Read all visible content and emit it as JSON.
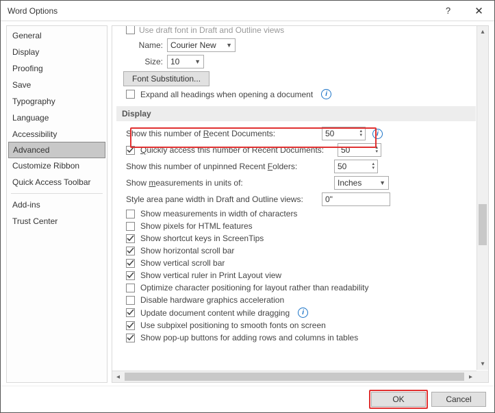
{
  "title": "Word Options",
  "sidebar": {
    "items": [
      {
        "label": "General"
      },
      {
        "label": "Display"
      },
      {
        "label": "Proofing"
      },
      {
        "label": "Save"
      },
      {
        "label": "Typography"
      },
      {
        "label": "Language"
      },
      {
        "label": "Accessibility"
      },
      {
        "label": "Advanced",
        "selected": true
      },
      {
        "label": "Customize Ribbon"
      },
      {
        "label": "Quick Access Toolbar"
      },
      {
        "sep": true
      },
      {
        "label": "Add-ins"
      },
      {
        "label": "Trust Center"
      }
    ]
  },
  "font": {
    "draft_label": "Use draft font in Draft and Outline views",
    "name_label": "Name:",
    "name_value": "Courier New",
    "size_label": "Size:",
    "size_value": "10",
    "sub_button": "Font Substitution...",
    "expand": "Expand all headings when opening a document"
  },
  "display": {
    "header": "Display",
    "recent_docs_label": "Show this number of Recent Documents:",
    "recent_docs_value": "50",
    "quick_access_label": "Quickly access this number of Recent Documents:",
    "quick_access_value": "50",
    "unpinned_label": "Show this number of unpinned Recent Folders:",
    "unpinned_value": "50",
    "units_label": "Show measurements in units of:",
    "units_value": "Inches",
    "style_pane_label": "Style area pane width in Draft and Outline views:",
    "style_pane_value": "0\"",
    "checks": [
      {
        "label": "Show measurements in width of characters",
        "checked": false,
        "u": "w"
      },
      {
        "label": "Show pixels for HTML features",
        "checked": false,
        "u": "x"
      },
      {
        "label": "Show shortcut keys in ScreenTips",
        "checked": true,
        "u": "h"
      },
      {
        "label": "Show horizontal scroll bar",
        "checked": true,
        "u": "z"
      },
      {
        "label": "Show vertical scroll bar",
        "checked": true,
        "u": "v"
      },
      {
        "label": "Show vertical ruler in Print Layout view",
        "checked": true
      },
      {
        "label": "Optimize character positioning for layout rather than readability",
        "checked": false
      },
      {
        "label": "Disable hardware graphics acceleration",
        "checked": false
      },
      {
        "label": "Update document content while dragging",
        "checked": true,
        "info": true,
        "u": "d"
      },
      {
        "label": "Use subpixel positioning to smooth fonts on screen",
        "checked": true
      },
      {
        "label": "Show pop-up buttons for adding rows and columns in tables",
        "checked": true
      }
    ]
  },
  "footer": {
    "ok": "OK",
    "cancel": "Cancel"
  }
}
